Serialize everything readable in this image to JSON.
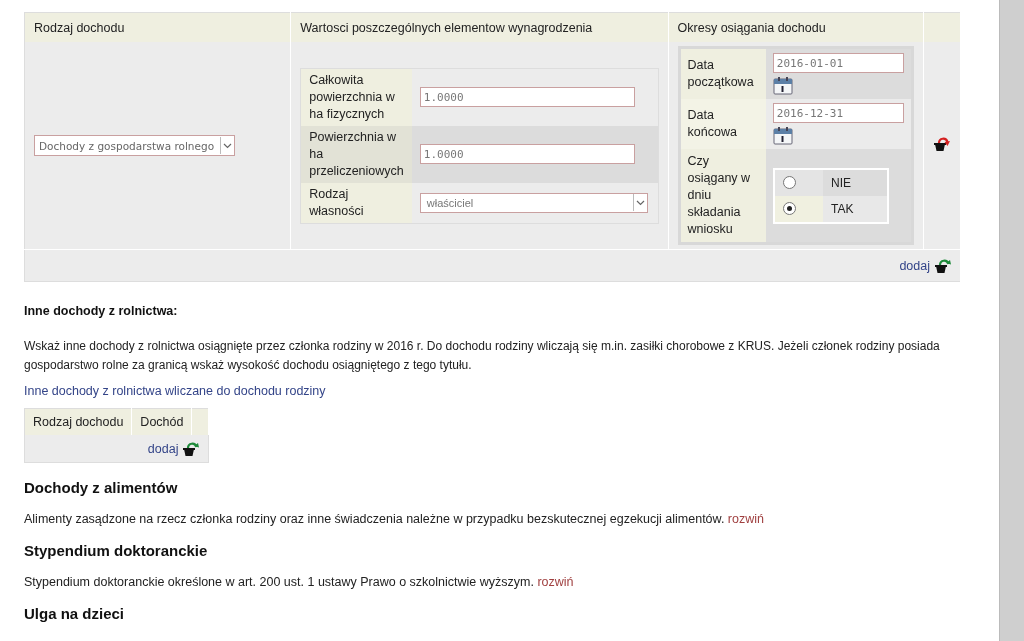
{
  "income_table": {
    "columns": [
      "Rodzaj dochodu",
      "Wartosci poszczególnych elementow wynagrodzenia",
      "Okresy osiągania dochodu"
    ],
    "row": {
      "income_type": "Dochody z gospodarstwa rolnego",
      "values": [
        {
          "kind": "input",
          "label": "Całkowita powierzchnia w ha fizycznych",
          "value": "1.0000"
        },
        {
          "kind": "input",
          "label": "Powierzchnia w ha przeliczeniowych",
          "value": "1.0000"
        },
        {
          "kind": "select",
          "label": "Rodzaj własności",
          "value": "właściciel"
        }
      ],
      "periods": [
        {
          "kind": "date",
          "label": "Data początkowa",
          "value": "2016-01-01"
        },
        {
          "kind": "date",
          "label": "Data końcowa",
          "value": "2016-12-31"
        },
        {
          "kind": "radio",
          "label": "Czy osiągany w dniu składania wniosku",
          "options": [
            {
              "label": "NIE",
              "selected": false
            },
            {
              "label": "TAK",
              "selected": true
            }
          ]
        }
      ]
    },
    "add_link": "dodaj"
  },
  "other_farm_income": {
    "title": "Inne dochody z rolnictwa:",
    "description": "Wskaż inne dochody z rolnictwa osiągnięte przez członka rodziny w 2016 r. Do dochodu rodziny wliczają się m.in. zasiłki chorobowe z KRUS. Jeżeli członek rodziny posiada gospodarstwo rolne za granicą wskaż wysokość dochodu osiągniętego z tego tytułu.",
    "link": "Inne dochody z rolnictwa wliczane do dochodu rodziny",
    "table": {
      "columns": [
        "Rodzaj dochodu",
        "Dochód"
      ],
      "add_link": "dodaj"
    }
  },
  "sections": [
    {
      "title": "Dochody z alimentów",
      "text": "Alimenty zasądzone na rzecz członka rodziny oraz inne świadczenia należne w przypadku bezskutecznej egzekucji alimentów.",
      "link": "rozwiń"
    },
    {
      "title": "Stypendium doktoranckie",
      "text": "Stypendium doktoranckie określone w art. 200 ust. 1 ustawy Prawo o szkolnictwie wyższym.",
      "link": "rozwiń"
    },
    {
      "title": "Ulga na dzieci"
    }
  ]
}
